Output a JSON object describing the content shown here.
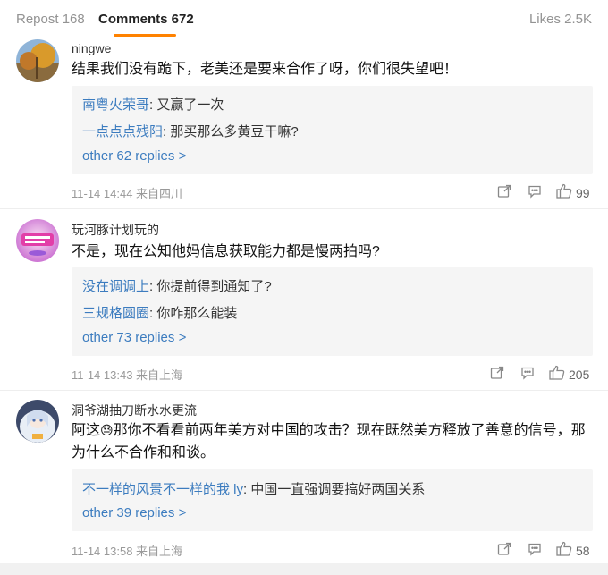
{
  "tabs": {
    "repost": "Repost 168",
    "comments": "Comments 672",
    "likes": "Likes 2.5K"
  },
  "comments": [
    {
      "username": "ningwe",
      "text": "结果我们没有跪下，老美还是要来合作了呀，你们很失望吧！",
      "replies": [
        {
          "user": "南粤火荣哥",
          "text": ": 又赢了一次"
        },
        {
          "user": "一点点点残阳",
          "text": ": 那买那么多黄豆干嘛?"
        }
      ],
      "more_replies": "other 62 replies >",
      "meta": "11-14 14:44  来自四川",
      "likes": "99"
    },
    {
      "username": "玩河豚计划玩的",
      "text": "不是，现在公知他妈信息获取能力都是慢两拍吗?",
      "replies": [
        {
          "user": "没在调调上",
          "text": ": 你提前得到通知了?"
        },
        {
          "user": "三规格圆圈",
          "text": ": 你咋那么能装"
        }
      ],
      "more_replies": "other 73 replies >",
      "meta": "11-14 13:43  来自上海",
      "likes": "205"
    },
    {
      "username": "洞爷湖抽刀断水水更流",
      "text_prefix": "阿这",
      "emoji": "😓",
      "text": "那你不看看前两年美方对中国的攻击？现在既然美方释放了善意的信号，那为什么不合作和和谈。",
      "replies": [
        {
          "user": "不一样的风景不一样的我 ly",
          "text": ": 中国一直强调要搞好两国关系"
        }
      ],
      "more_replies": "other 39 replies >",
      "meta": "11-14 13:58  来自上海",
      "likes": "58"
    }
  ],
  "colors": {
    "accent": "#ff8200",
    "link": "#3c7cbf",
    "reply_bg": "#f5f5f5",
    "meta": "#999999"
  },
  "icons": [
    "share-icon",
    "comment-icon",
    "thumbs-up-icon"
  ]
}
